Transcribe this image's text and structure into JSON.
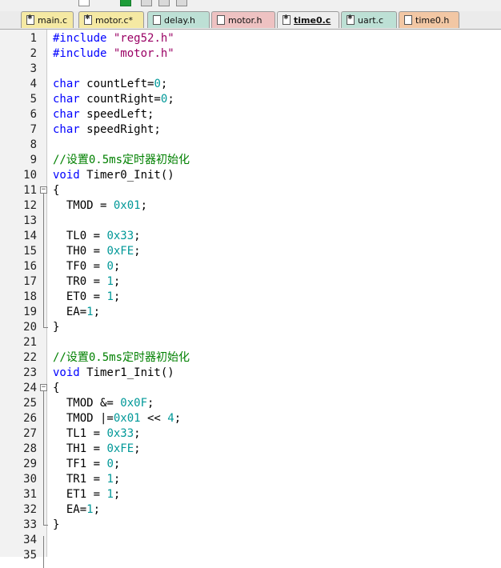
{
  "toolbar": {
    "icons": [
      "toolbar-button-icon",
      "toolbar-button-icon",
      "toolbar-button-icon",
      "toolbar-button-icon",
      "toolbar-button-icon",
      "toolbar-button-icon"
    ]
  },
  "tabs": [
    {
      "label": "main.c",
      "icon": "c-file-icon",
      "color": "#f5e9a3",
      "active": false
    },
    {
      "label": "motor.c*",
      "icon": "c-file-icon",
      "color": "#f5e9a3",
      "active": false
    },
    {
      "label": "delay.h",
      "icon": "h-file-icon",
      "color": "#bde0d5",
      "active": false
    },
    {
      "label": "motor.h",
      "icon": "h-file-icon",
      "color": "#eec2c2",
      "active": false
    },
    {
      "label": "time0.c",
      "icon": "c-file-icon",
      "color": "#eeeeee",
      "active": true
    },
    {
      "label": "uart.c",
      "icon": "c-file-icon",
      "color": "#bde0d5",
      "active": false
    },
    {
      "label": "time0.h",
      "icon": "h-file-icon",
      "color": "#f2c7a4",
      "active": false
    }
  ],
  "colors": {
    "keyword": "#0000ff",
    "string": "#9a0064",
    "number": "#009898",
    "comment": "#008000"
  },
  "code": {
    "lines": [
      {
        "n": "1",
        "text": "#include \"reg52.h\""
      },
      {
        "n": "2",
        "text": "#include \"motor.h\""
      },
      {
        "n": "3",
        "text": ""
      },
      {
        "n": "4",
        "text": "char countLeft=0;"
      },
      {
        "n": "5",
        "text": "char countRight=0;"
      },
      {
        "n": "6",
        "text": "char speedLeft;"
      },
      {
        "n": "7",
        "text": "char speedRight;"
      },
      {
        "n": "8",
        "text": ""
      },
      {
        "n": "9",
        "text": "//设置0.5ms定时器初始化"
      },
      {
        "n": "10",
        "text": "void Timer0_Init()"
      },
      {
        "n": "11",
        "text": "{"
      },
      {
        "n": "12",
        "text": "  TMOD = 0x01;"
      },
      {
        "n": "13",
        "text": ""
      },
      {
        "n": "14",
        "text": "  TL0 = 0x33;"
      },
      {
        "n": "15",
        "text": "  TH0 = 0xFE;"
      },
      {
        "n": "16",
        "text": "  TF0 = 0;"
      },
      {
        "n": "17",
        "text": "  TR0 = 1;"
      },
      {
        "n": "18",
        "text": "  ET0 = 1;"
      },
      {
        "n": "19",
        "text": "  EA=1;"
      },
      {
        "n": "20",
        "text": "}"
      },
      {
        "n": "21",
        "text": ""
      },
      {
        "n": "22",
        "text": "//设置0.5ms定时器初始化"
      },
      {
        "n": "23",
        "text": "void Timer1_Init()"
      },
      {
        "n": "24",
        "text": "{"
      },
      {
        "n": "25",
        "text": "  TMOD &= 0x0F;"
      },
      {
        "n": "26",
        "text": "  TMOD |=0x01 << 4;"
      },
      {
        "n": "27",
        "text": "  TL1 = 0x33;"
      },
      {
        "n": "28",
        "text": "  TH1 = 0xFE;"
      },
      {
        "n": "29",
        "text": "  TF1 = 0;"
      },
      {
        "n": "30",
        "text": "  TR1 = 1;"
      },
      {
        "n": "31",
        "text": "  ET1 = 1;"
      },
      {
        "n": "32",
        "text": "  EA=1;"
      },
      {
        "n": "33",
        "text": "}"
      },
      {
        "n": "34",
        "text": ""
      },
      {
        "n": "35",
        "text": ""
      }
    ],
    "fold_markers": [
      {
        "line": "11",
        "symbol": "−"
      },
      {
        "line": "24",
        "symbol": "−"
      }
    ]
  }
}
